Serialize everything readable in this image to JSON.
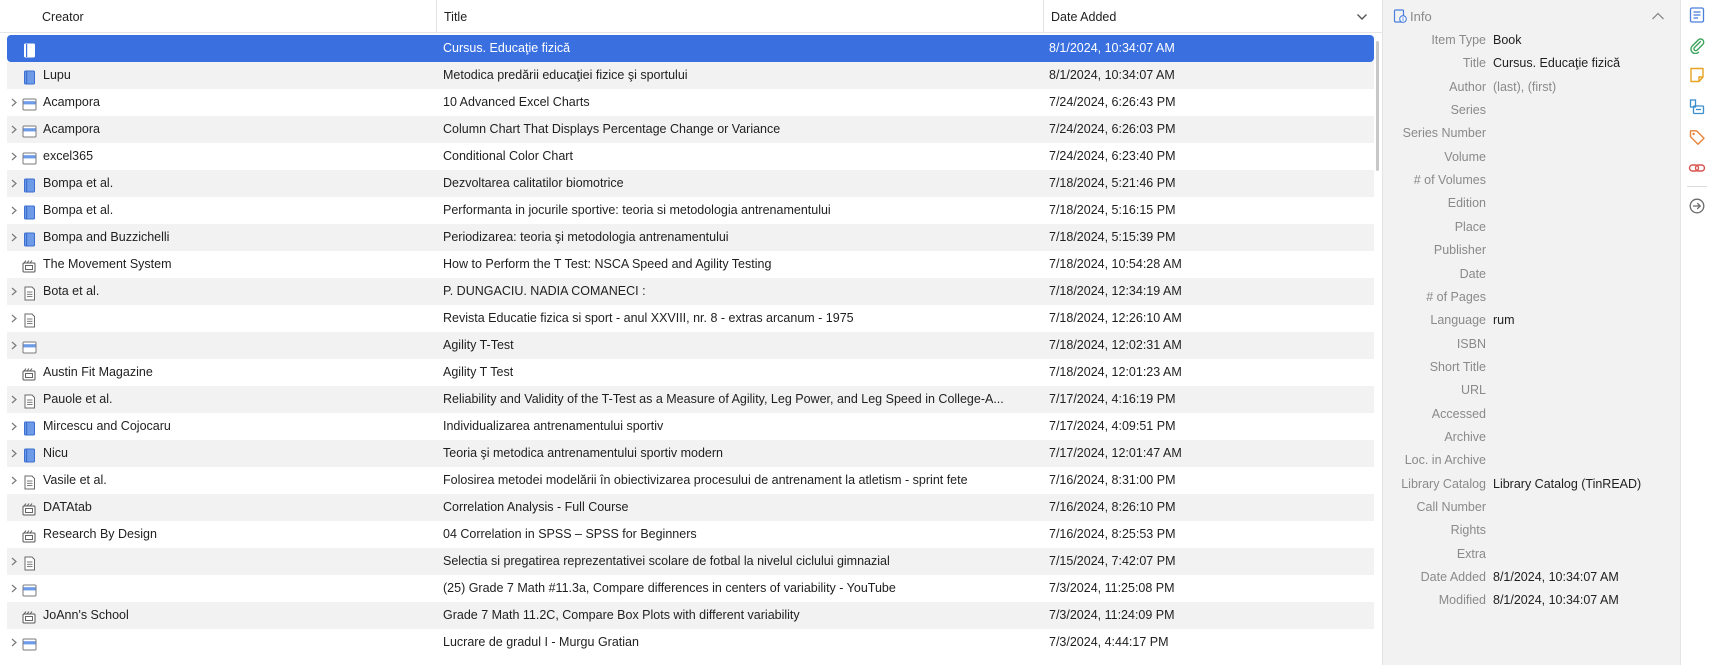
{
  "columns": {
    "creator": "Creator",
    "title": "Title",
    "date_added": "Date Added"
  },
  "rows": [
    {
      "twisty": false,
      "icon": "book",
      "creator": "",
      "title": "Cursus. Educaţie fizică",
      "date": "8/1/2024, 10:34:07 AM",
      "selected": true
    },
    {
      "twisty": false,
      "icon": "book",
      "creator": "Lupu",
      "title": "Metodica predării educaţiei fizice şi sportului",
      "date": "8/1/2024, 10:34:07 AM"
    },
    {
      "twisty": true,
      "icon": "webpage",
      "creator": "Acampora",
      "title": "10 Advanced Excel Charts",
      "date": "7/24/2024, 6:26:43 PM"
    },
    {
      "twisty": true,
      "icon": "webpage",
      "creator": "Acampora",
      "title": "Column Chart That Displays Percentage Change or Variance",
      "date": "7/24/2024, 6:26:03 PM"
    },
    {
      "twisty": true,
      "icon": "webpage",
      "creator": "excel365",
      "title": "Conditional Color Chart",
      "date": "7/24/2024, 6:23:40 PM"
    },
    {
      "twisty": true,
      "icon": "book",
      "creator": "Bompa et al.",
      "title": "Dezvoltarea calitatilor biomotrice",
      "date": "7/18/2024, 5:21:46 PM"
    },
    {
      "twisty": true,
      "icon": "book",
      "creator": "Bompa et al.",
      "title": "Performanta in jocurile sportive: teoria si metodologia antrenamentului",
      "date": "7/18/2024, 5:16:15 PM"
    },
    {
      "twisty": true,
      "icon": "book",
      "creator": "Bompa and Buzzichelli",
      "title": "Periodizarea: teoria şi metodologia antrenamentului",
      "date": "7/18/2024, 5:15:39 PM"
    },
    {
      "twisty": false,
      "icon": "video",
      "creator": "The Movement System",
      "title": "How to Perform the T Test: NSCA Speed and Agility Testing",
      "date": "7/18/2024, 10:54:28 AM"
    },
    {
      "twisty": true,
      "icon": "document",
      "creator": "Bota et al.",
      "title": "P. DUNGACIU. NADIA COMANECI :",
      "date": "7/18/2024, 12:34:19 AM"
    },
    {
      "twisty": true,
      "icon": "document",
      "creator": "",
      "title": "Revista Educatie fizica si sport - anul XXVIII, nr. 8 - extras arcanum - 1975",
      "date": "7/18/2024, 12:26:10 AM"
    },
    {
      "twisty": true,
      "icon": "webpage",
      "creator": "",
      "title": "Agility T-Test",
      "date": "7/18/2024, 12:02:31 AM"
    },
    {
      "twisty": false,
      "icon": "video",
      "creator": "Austin Fit Magazine",
      "title": "Agility T Test",
      "date": "7/18/2024, 12:01:23 AM"
    },
    {
      "twisty": true,
      "icon": "document",
      "creator": "Pauole et al.",
      "title": "Reliability and Validity of the T-Test as a Measure of Agility, Leg Power, and Leg Speed in College-A...",
      "date": "7/17/2024, 4:16:19 PM"
    },
    {
      "twisty": true,
      "icon": "book",
      "creator": "Mircescu and Cojocaru",
      "title": "Individualizarea antrenamentului sportiv",
      "date": "7/17/2024, 4:09:51 PM"
    },
    {
      "twisty": true,
      "icon": "book",
      "creator": "Nicu",
      "title": "Teoria şi metodica antrenamentului sportiv modern",
      "date": "7/17/2024, 12:01:47 AM"
    },
    {
      "twisty": true,
      "icon": "document",
      "creator": "Vasile et al.",
      "title": "Folosirea metodei modelării în obiectivizarea procesului de antrenament la atletism - sprint fete",
      "date": "7/16/2024, 8:31:00 PM"
    },
    {
      "twisty": false,
      "icon": "video",
      "creator": "DATAtab",
      "title": "Correlation Analysis - Full Course",
      "date": "7/16/2024, 8:26:10 PM"
    },
    {
      "twisty": false,
      "icon": "video",
      "creator": "Research By Design",
      "title": "04 Correlation in SPSS – SPSS for Beginners",
      "date": "7/16/2024, 8:25:53 PM"
    },
    {
      "twisty": true,
      "icon": "document",
      "creator": "",
      "title": "Selectia si pregatirea reprezentativei scolare de fotbal la nivelul ciclului gimnazial",
      "date": "7/15/2024, 7:42:07 PM"
    },
    {
      "twisty": true,
      "icon": "webpage",
      "creator": "",
      "title": "(25) Grade 7 Math #11.3a, Compare differences in centers of variability - YouTube",
      "date": "7/3/2024, 11:25:08 PM"
    },
    {
      "twisty": false,
      "icon": "video",
      "creator": "JoAnn's School",
      "title": "Grade 7 Math 11.2C, Compare Box Plots with different variability",
      "date": "7/3/2024, 11:24:09 PM"
    },
    {
      "twisty": true,
      "icon": "webpage",
      "creator": "",
      "title": "Lucrare de gradul I - Murgu Gratian",
      "date": "7/3/2024, 4:44:17 PM"
    }
  ],
  "info": {
    "section_label": "Info",
    "fields": [
      {
        "label": "Item Type",
        "value": "Book"
      },
      {
        "label": "Title",
        "value": "Cursus. Educaţie fizică"
      },
      {
        "label": "Author",
        "value": "",
        "placeholder_last": "(last)",
        "placeholder_first": "(first)"
      },
      {
        "label": "Series",
        "value": ""
      },
      {
        "label": "Series Number",
        "value": ""
      },
      {
        "label": "Volume",
        "value": ""
      },
      {
        "label": "# of Volumes",
        "value": ""
      },
      {
        "label": "Edition",
        "value": ""
      },
      {
        "label": "Place",
        "value": ""
      },
      {
        "label": "Publisher",
        "value": ""
      },
      {
        "label": "Date",
        "value": ""
      },
      {
        "label": "# of Pages",
        "value": ""
      },
      {
        "label": "Language",
        "value": "rum"
      },
      {
        "label": "ISBN",
        "value": ""
      },
      {
        "label": "Short Title",
        "value": ""
      },
      {
        "label": "URL",
        "value": ""
      },
      {
        "label": "Accessed",
        "value": ""
      },
      {
        "label": "Archive",
        "value": ""
      },
      {
        "label": "Loc. in Archive",
        "value": ""
      },
      {
        "label": "Library Catalog",
        "value": "Library Catalog (TinREAD)"
      },
      {
        "label": "Call Number",
        "value": ""
      },
      {
        "label": "Rights",
        "value": ""
      },
      {
        "label": "Extra",
        "value": ""
      },
      {
        "label": "Date Added",
        "value": "8/1/2024, 10:34:07 AM"
      },
      {
        "label": "Modified",
        "value": "8/1/2024, 10:34:07 AM"
      }
    ]
  },
  "side_nav": [
    {
      "name": "info-nav-icon",
      "color": "#4a7fdc"
    },
    {
      "name": "attachments-nav-icon",
      "color": "#3aa35a"
    },
    {
      "name": "notes-nav-icon",
      "color": "#e7a321"
    },
    {
      "name": "libraries-collections-nav-icon",
      "color": "#3a8fd0"
    },
    {
      "name": "tags-nav-icon",
      "color": "#e8833a"
    },
    {
      "name": "related-nav-icon",
      "color": "#d9534f"
    },
    {
      "name": "locate-nav-icon",
      "color": "#6b6b6b"
    }
  ],
  "colors": {
    "selection": "#3a6fe0",
    "alt_row": "#f2f2f2",
    "pane_bg": "#f2f2f2",
    "label_gray": "#8a8a8a"
  }
}
